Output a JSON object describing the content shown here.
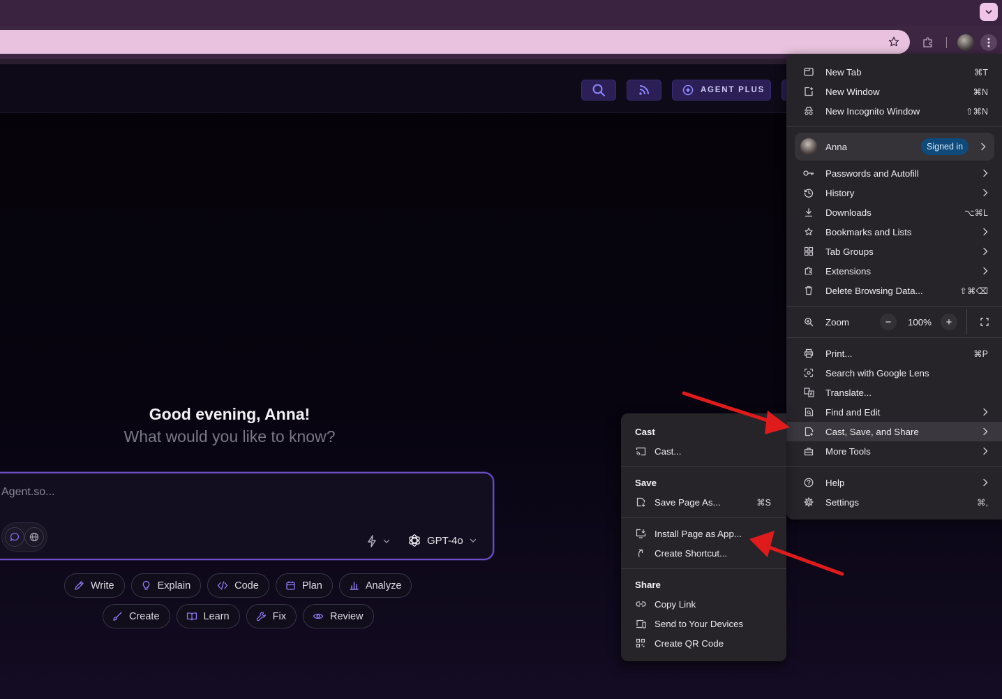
{
  "browser": {
    "omnibox_url": "",
    "menu": {
      "top_items": [
        {
          "label": "New Tab",
          "shortcut": "⌘T",
          "icon": "new-tab-icon"
        },
        {
          "label": "New Window",
          "shortcut": "⌘N",
          "icon": "new-window-icon"
        },
        {
          "label": "New Incognito Window",
          "shortcut": "⇧⌘N",
          "icon": "incognito-icon"
        }
      ],
      "profile": {
        "name": "Anna",
        "badge": "Signed in"
      },
      "middle_items": [
        {
          "label": "Passwords and Autofill",
          "icon": "key-icon"
        },
        {
          "label": "History",
          "icon": "history-icon"
        },
        {
          "label": "Downloads",
          "shortcut": "⌥⌘L",
          "icon": "download-icon"
        },
        {
          "label": "Bookmarks and Lists",
          "icon": "star-icon"
        },
        {
          "label": "Tab Groups",
          "icon": "tab-groups-icon"
        },
        {
          "label": "Extensions",
          "icon": "puzzle-icon"
        },
        {
          "label": "Delete Browsing Data...",
          "shortcut": "⇧⌘⌫",
          "icon": "trash-icon"
        }
      ],
      "zoom": {
        "label": "Zoom",
        "value": "100%",
        "minus": "−",
        "plus": "+"
      },
      "tool_items": [
        {
          "label": "Print...",
          "shortcut": "⌘P",
          "icon": "print-icon"
        },
        {
          "label": "Search with Google Lens",
          "icon": "lens-icon"
        },
        {
          "label": "Translate...",
          "icon": "translate-icon"
        },
        {
          "label": "Find and Edit",
          "icon": "find-icon"
        },
        {
          "label": "Cast, Save, and Share",
          "icon": "cast-save-share-icon"
        },
        {
          "label": "More Tools",
          "icon": "toolbox-icon"
        }
      ],
      "bottom_items": [
        {
          "label": "Help",
          "icon": "help-icon"
        },
        {
          "label": "Settings",
          "shortcut": "⌘,",
          "icon": "gear-icon"
        }
      ]
    },
    "submenu": {
      "cast_header": "Cast",
      "cast_item": "Cast...",
      "save_header": "Save",
      "save_item": "Save Page As...",
      "save_shortcut": "⌘S",
      "install_item": "Install Page as App...",
      "shortcut_item": "Create Shortcut...",
      "share_header": "Share",
      "share_items": [
        "Copy Link",
        "Send to Your Devices",
        "Create QR Code"
      ]
    }
  },
  "app": {
    "header": {
      "agent_plus": "AGENT PLUS"
    },
    "greeting": "Good evening, Anna!",
    "subgreeting": "What would you like to know?",
    "composer": {
      "placeholder": "Agent.so...",
      "model": "GPT-4o"
    },
    "chips_row1": [
      "Write",
      "Explain",
      "Code",
      "Plan",
      "Analyze"
    ],
    "chips_row2": [
      "Create",
      "Learn",
      "Fix",
      "Review"
    ]
  },
  "colors": {
    "accent": "#6c4ec8",
    "annotation": "#e01b1b",
    "signed_in_badge": "#0f4a7a"
  }
}
